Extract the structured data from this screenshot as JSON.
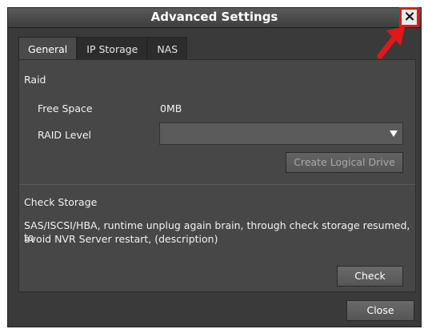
{
  "window": {
    "title": "Advanced Settings"
  },
  "close_icon": "×",
  "tabs": [
    {
      "label": "General",
      "active": true
    },
    {
      "label": "IP Storage",
      "active": false
    },
    {
      "label": "NAS",
      "active": false
    }
  ],
  "raid": {
    "section_title": "Raid",
    "free_space_label": "Free Space",
    "free_space_value": "0MB",
    "raid_level_label": "RAID Level",
    "raid_level_value": "",
    "create_button": "Create Logical Drive"
  },
  "check_storage": {
    "section_title": "Check Storage",
    "description_line1": "SAS/ISCSI/HBA, runtime unplug again brain, through check storage resumed, to",
    "description_line2": "avoid NVR Server restart, (description)",
    "check_button": "Check"
  },
  "footer": {
    "close_button": "Close"
  },
  "colors": {
    "annotation": "#e01818"
  }
}
